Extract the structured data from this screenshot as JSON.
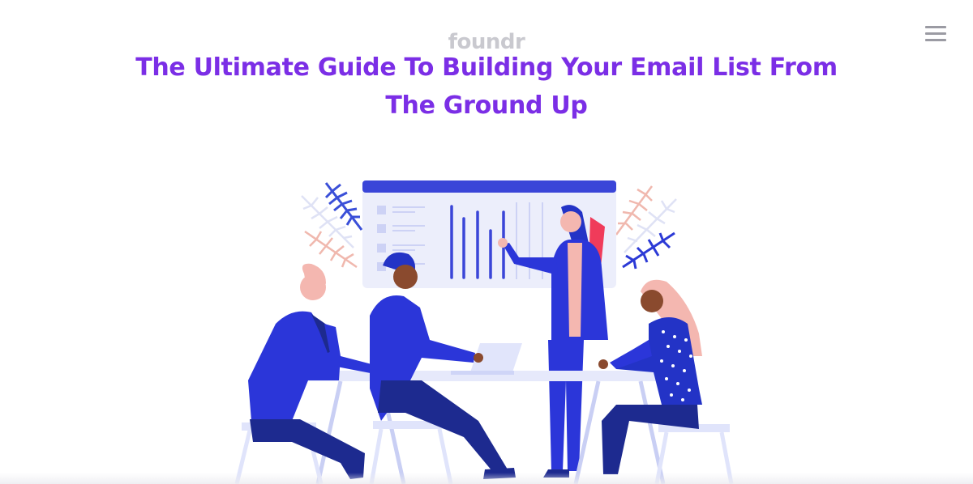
{
  "header": {
    "logo_text": "foundr",
    "menu_icon": "hamburger-menu-icon"
  },
  "article": {
    "title": "The Ultimate Guide To Building Your Email List From The Ground Up"
  },
  "hero_image": {
    "subject": "team-meeting-illustration",
    "colors": {
      "primary": "#2b36d9",
      "dark": "#1d2a8f",
      "accent": "#7b2ee6",
      "pink": "#f4b7b0",
      "light": "#e8ebfb"
    }
  }
}
